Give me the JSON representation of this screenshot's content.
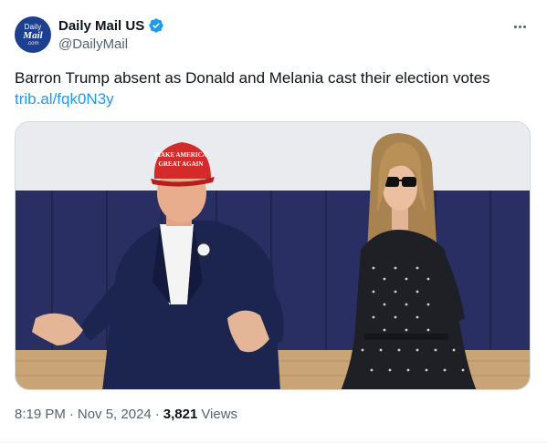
{
  "account": {
    "avatar_text": [
      "Daily",
      "Mail",
      ".com"
    ],
    "display_name": "Daily Mail US",
    "handle": "@DailyMail",
    "verified_color": "#1d9bf0"
  },
  "tweet": {
    "text": "Barron Trump absent as Donald and Melania cast their election votes",
    "link": "trib.al/fqk0N3y"
  },
  "media": {
    "hat_text": [
      "MAKE AMERICA",
      "GREAT AGAIN"
    ]
  },
  "meta": {
    "time": "8:19 PM",
    "separator": "·",
    "date": "Nov 5, 2024",
    "views_count": "3,821",
    "views_label": "Views"
  },
  "colors": {
    "text_primary": "#0f1419",
    "text_secondary": "#536471",
    "link": "#1d9bf0",
    "border": "#cfd9de"
  }
}
